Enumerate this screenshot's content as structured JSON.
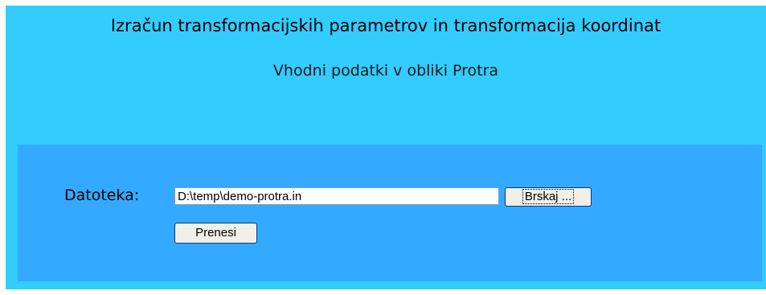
{
  "page": {
    "title": "Izračun transformacijskih parametrov in transformacija koordinat",
    "subtitle": "Vhodni podatki v obliki Protra"
  },
  "form": {
    "file_label": "Datoteka:",
    "file_value": "D:\\temp\\demo-protra.in",
    "browse_label": "Brskaj ...",
    "upload_label": "Prenesi"
  },
  "colors": {
    "page_background": "#33ccff",
    "panel_background": "#33aaff"
  }
}
